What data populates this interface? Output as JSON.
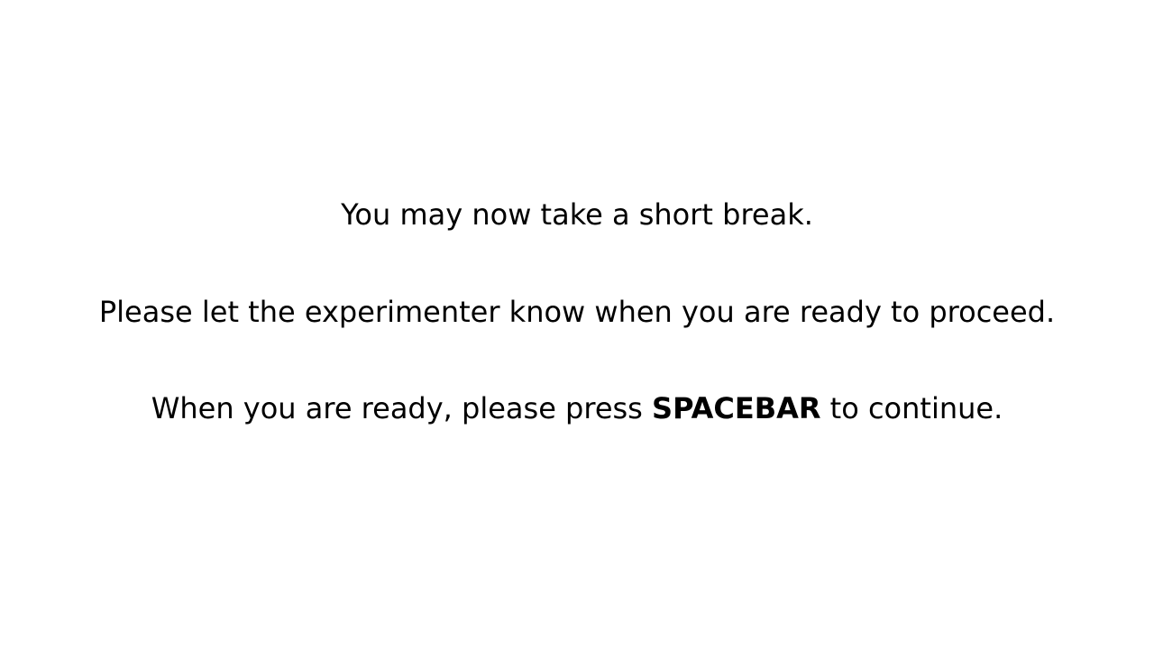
{
  "instructions": {
    "line1": "You may now take a short break.",
    "line2": "Please let the experimenter know when you are ready to proceed.",
    "line3_before": "When you are ready, please press ",
    "line3_key": "SPACEBAR",
    "line3_after": " to continue."
  },
  "colors": {
    "background": "#ffffff",
    "text": "#000000"
  }
}
